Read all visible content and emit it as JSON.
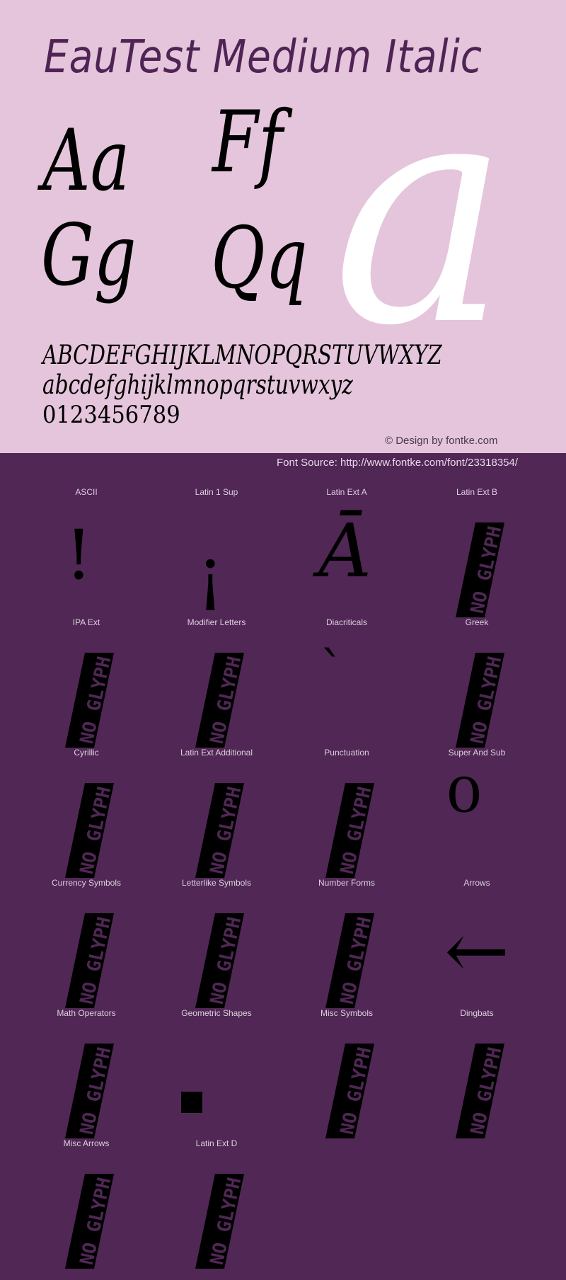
{
  "colors": {
    "top_background": "#E5C5DB",
    "bottom_background": "#502755",
    "title_color": "#4F2455",
    "glyph_color": "#000000",
    "hero_glyph_color": "#FFFFFF",
    "noglyph_text_color": "#502755"
  },
  "header": {
    "title": "EauTest Medium Italic"
  },
  "samples": {
    "pairs": [
      "Aa",
      "Ff",
      "Gg",
      "Qq"
    ],
    "hero_glyph": "a"
  },
  "alphabet": {
    "uppercase": "ABCDEFGHIJKLMNOPQRSTUVWXYZ",
    "lowercase": "abcdefghijklmnopqrstuvwxyz",
    "digits": "0123456789"
  },
  "credit": "© Design by fontke.com",
  "source": "Font Source: http://www.fontke.com/font/23318354/",
  "noglyph_text": "NO GLYPH",
  "blocks": [
    {
      "label": "ASCII",
      "glyph": "!",
      "has_glyph": true
    },
    {
      "label": "Latin 1 Sup",
      "glyph": "¡",
      "has_glyph": true
    },
    {
      "label": "Latin Ext A",
      "glyph": "Ā",
      "has_glyph": true
    },
    {
      "label": "Latin Ext B",
      "glyph": "",
      "has_glyph": false
    },
    {
      "label": "IPA Ext",
      "glyph": "",
      "has_glyph": false
    },
    {
      "label": "Modifier Letters",
      "glyph": "",
      "has_glyph": false
    },
    {
      "label": "Diacriticals",
      "glyph": "`",
      "has_glyph": true
    },
    {
      "label": "Greek",
      "glyph": "",
      "has_glyph": false
    },
    {
      "label": "Cyrillic",
      "glyph": "",
      "has_glyph": false
    },
    {
      "label": "Latin Ext Additional",
      "glyph": "",
      "has_glyph": false
    },
    {
      "label": "Punctuation",
      "glyph": "",
      "has_glyph": false
    },
    {
      "label": "Super And Sub",
      "glyph": "⁰",
      "has_glyph": true
    },
    {
      "label": "Currency Symbols",
      "glyph": "",
      "has_glyph": false
    },
    {
      "label": "Letterlike Symbols",
      "glyph": "",
      "has_glyph": false
    },
    {
      "label": "Number Forms",
      "glyph": "",
      "has_glyph": false
    },
    {
      "label": "Arrows",
      "glyph": "←",
      "has_glyph": true
    },
    {
      "label": "Math Operators",
      "glyph": "",
      "has_glyph": false
    },
    {
      "label": "Geometric Shapes",
      "glyph": "■",
      "has_glyph": true
    },
    {
      "label": "Misc Symbols",
      "glyph": "",
      "has_glyph": false
    },
    {
      "label": "Dingbats",
      "glyph": "",
      "has_glyph": false
    },
    {
      "label": "Misc Arrows",
      "glyph": "",
      "has_glyph": false
    },
    {
      "label": "Latin Ext D",
      "glyph": "",
      "has_glyph": false
    }
  ]
}
